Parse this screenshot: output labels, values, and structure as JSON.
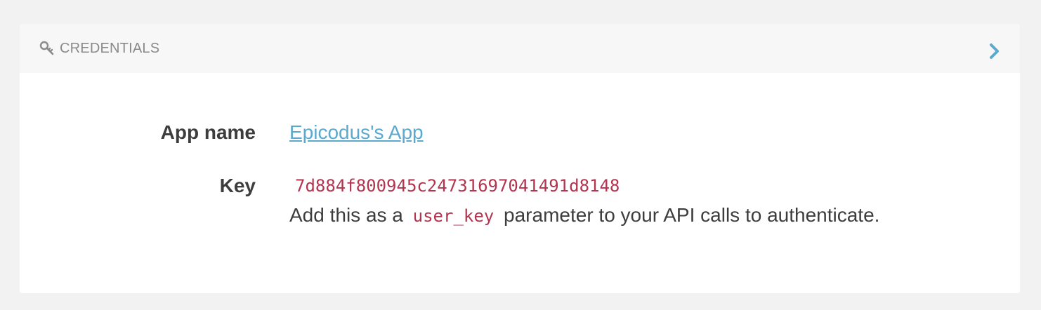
{
  "header": {
    "icon": "key-icon",
    "title": "CREDENTIALS",
    "toggle_icon": "chevron-right-icon",
    "accent_color": "#5ba9cf"
  },
  "fields": {
    "app_name": {
      "label": "App name",
      "value": "Epicodus's App"
    },
    "key": {
      "label": "Key",
      "value": "7d884f800945c24731697041491d8148",
      "help_prefix": "Add this as a",
      "help_code": "user_key",
      "help_suffix": "parameter to your API calls to authenticate."
    }
  },
  "colors": {
    "link": "#5ba9cf",
    "code": "#b2344f",
    "label": "#3d3d3d",
    "header_text": "#8a8a8a"
  }
}
